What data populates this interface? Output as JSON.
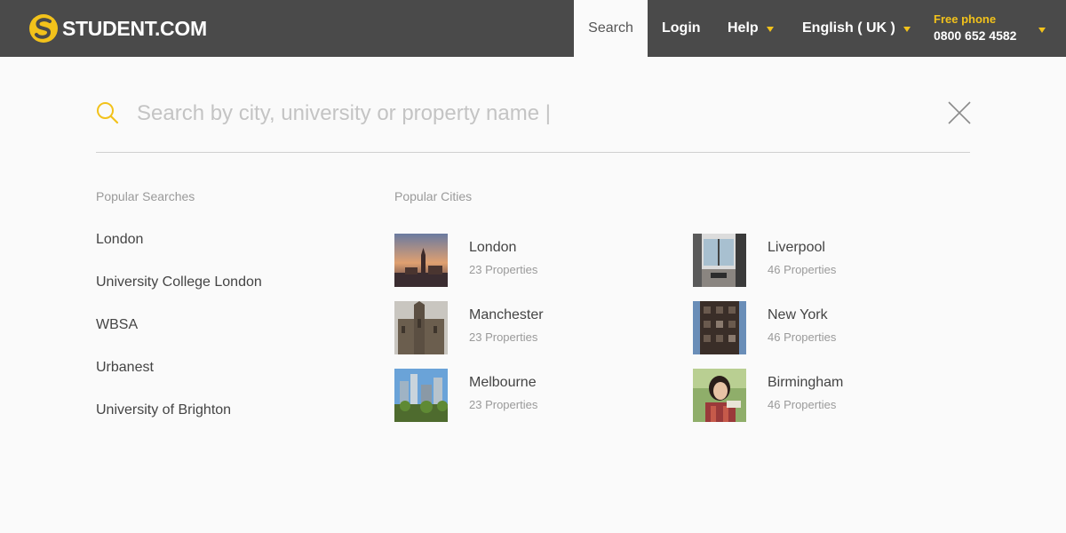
{
  "header": {
    "logo_text": "STUDENT.COM",
    "nav": {
      "search": "Search",
      "login": "Login",
      "help": "Help",
      "language": "English ( UK )"
    },
    "phone": {
      "label": "Free phone",
      "number": "0800 652 4582"
    },
    "colors": {
      "bar": "#4a4a4a",
      "accent": "#f2c21b"
    }
  },
  "search": {
    "placeholder": "Search by city, university or property name |",
    "icon": "search-icon",
    "close_icon": "close-icon"
  },
  "popular_searches": {
    "title": "Popular Searches",
    "items": [
      "London",
      "University College London",
      "WBSA",
      "Urbanest",
      "University of Brighton"
    ]
  },
  "popular_cities": {
    "title": "Popular Cities",
    "items": [
      {
        "name": "London",
        "count": "23 Properties"
      },
      {
        "name": "Manchester",
        "count": "23 Properties"
      },
      {
        "name": "Melbourne",
        "count": "23 Properties"
      },
      {
        "name": "Liverpool",
        "count": "46 Properties"
      },
      {
        "name": "New York",
        "count": "46 Properties"
      },
      {
        "name": "Birmingham",
        "count": "46 Properties"
      }
    ]
  }
}
